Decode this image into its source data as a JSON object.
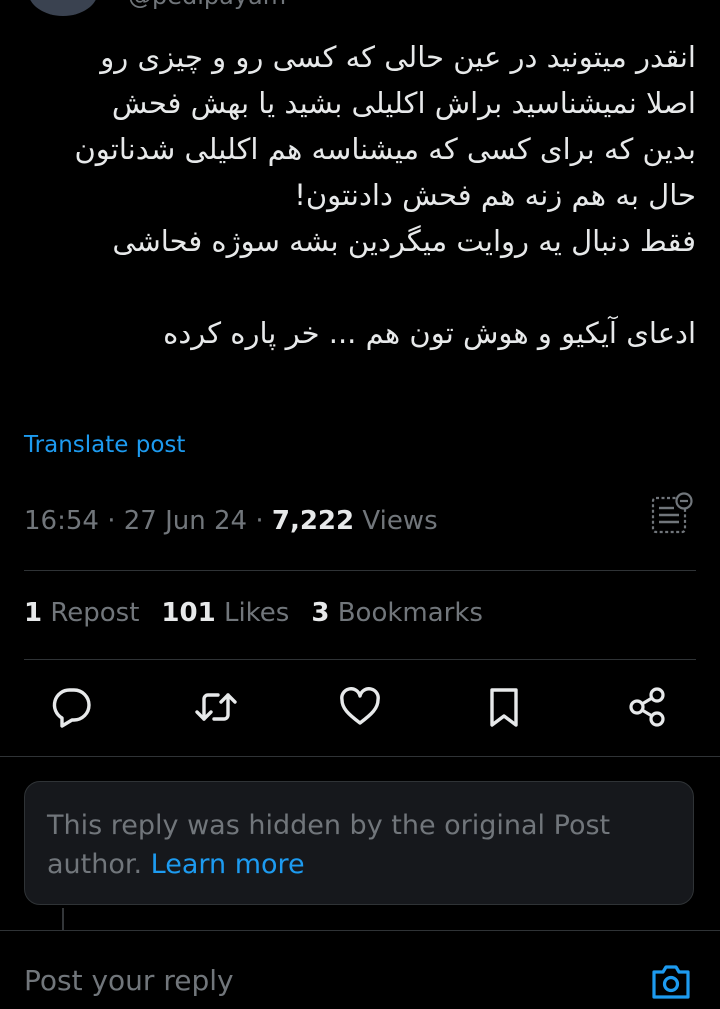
{
  "author": {
    "handle": "@pedipayam"
  },
  "post": {
    "lines": [
      "انقدر میتونید در عین حالی که کسی رو و چیزی رو",
      "اصلا نمیشناسید براش اکلیلی بشید یا بهش فحش",
      "بدین که برای کسی که میشناسه هم اکلیلی شدناتون",
      "حال به هم زنه هم فحش دادنتون!",
      "فقط دنبال یه روایت میگردین بشه سوژه فحاشی",
      "ادعای آیکیو و هوش تون هم ... خر پاره کرده"
    ],
    "translate_label": "Translate post"
  },
  "meta": {
    "time": "16:54",
    "sep": " · ",
    "date": "27 Jun 24",
    "views_count": "7,222",
    "views_label": " Views"
  },
  "stats": {
    "reposts_count": "1",
    "reposts_label": " Repost",
    "likes_count": "101",
    "likes_label": " Likes",
    "bookmarks_count": "3",
    "bookmarks_label": " Bookmarks"
  },
  "actions": [
    "reply-icon",
    "repost-icon",
    "like-icon",
    "bookmark-icon",
    "share-icon"
  ],
  "hidden_reply": {
    "text": "This reply was hidden by the original Post author. ",
    "link": "Learn more"
  },
  "composer": {
    "placeholder": "Post your reply"
  },
  "colors": {
    "accent": "#1d9bf0",
    "muted": "#71767b",
    "text": "#e7e9ea",
    "border": "#2f3336",
    "background": "#000000"
  }
}
